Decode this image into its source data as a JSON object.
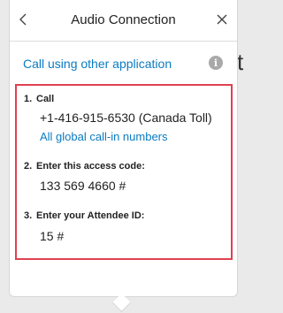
{
  "background_text": "t",
  "header": {
    "title": "Audio Connection",
    "back_icon": "chevron-left-icon",
    "close_icon": "close-icon"
  },
  "call_other_app": {
    "label": "Call using other application",
    "info_icon": "i"
  },
  "steps": [
    {
      "number": "1.",
      "label": "Call",
      "value": "+1-416-915-6530 (Canada Toll)",
      "link": "All global call-in numbers"
    },
    {
      "number": "2.",
      "label": "Enter this access code:",
      "value": "133 569 4660 #"
    },
    {
      "number": "3.",
      "label": "Enter your Attendee ID:",
      "value": "15 #"
    }
  ],
  "colors": {
    "link": "#0a7bc1",
    "highlight_border": "#e0414f",
    "info_badge": "#a9a9a9"
  }
}
